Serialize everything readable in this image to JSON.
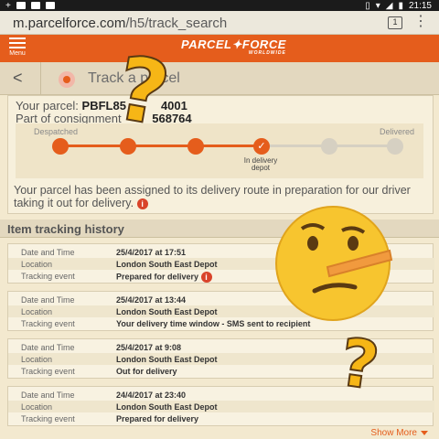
{
  "status_bar": {
    "time": "21:15",
    "icons": [
      "plus-icon",
      "dropbox-icon",
      "mail-icon",
      "screen-icon",
      "vibrate-icon",
      "wifi-icon",
      "signal-icon",
      "battery-icon"
    ]
  },
  "browser": {
    "url_domain": "m.parcelforce.com",
    "url_path": "/h5/track_search",
    "tab_count": "1"
  },
  "header": {
    "menu_label": "Menu",
    "logo_main": "PARCEL✦FORCE",
    "logo_sub": "WORLDWIDE",
    "brand_color": "#e55d1c"
  },
  "page": {
    "back": "<",
    "title": "Track a parcel"
  },
  "parcel": {
    "parcel_label": "Your parcel:",
    "parcel_number": "PBFL85",
    "parcel_suffix": "4001",
    "consignment_label": "Part of consignment",
    "consignment_number": "568764",
    "progress": {
      "start_label": "Despatched",
      "end_label": "Delivered",
      "steps_total": 6,
      "current_step": 4,
      "current_label": "In delivery depot"
    },
    "message": "Your parcel has been assigned to its delivery route in preparation for our driver taking it out for delivery."
  },
  "history": {
    "heading": "Item tracking history",
    "keys": {
      "date": "Date and Time",
      "location": "Location",
      "event": "Tracking event"
    },
    "events": [
      {
        "date": "25/4/2017 at 17:51",
        "location": "London South East Depot",
        "event": "Prepared for delivery",
        "info": true
      },
      {
        "date": "25/4/2017 at 13:44",
        "location": "London South East Depot",
        "event": "Your delivery time window - SMS sent to recipient",
        "info": false
      },
      {
        "date": "25/4/2017 at 9:08",
        "location": "London South East Depot",
        "event": "Out for delivery",
        "info": false
      },
      {
        "date": "24/4/2017 at 23:40",
        "location": "London South East Depot",
        "event": "Prepared for delivery",
        "info": false
      }
    ],
    "show_more": "Show More"
  },
  "overlays": {
    "question_mark": "?",
    "emoji": "thinking-face-icon"
  }
}
